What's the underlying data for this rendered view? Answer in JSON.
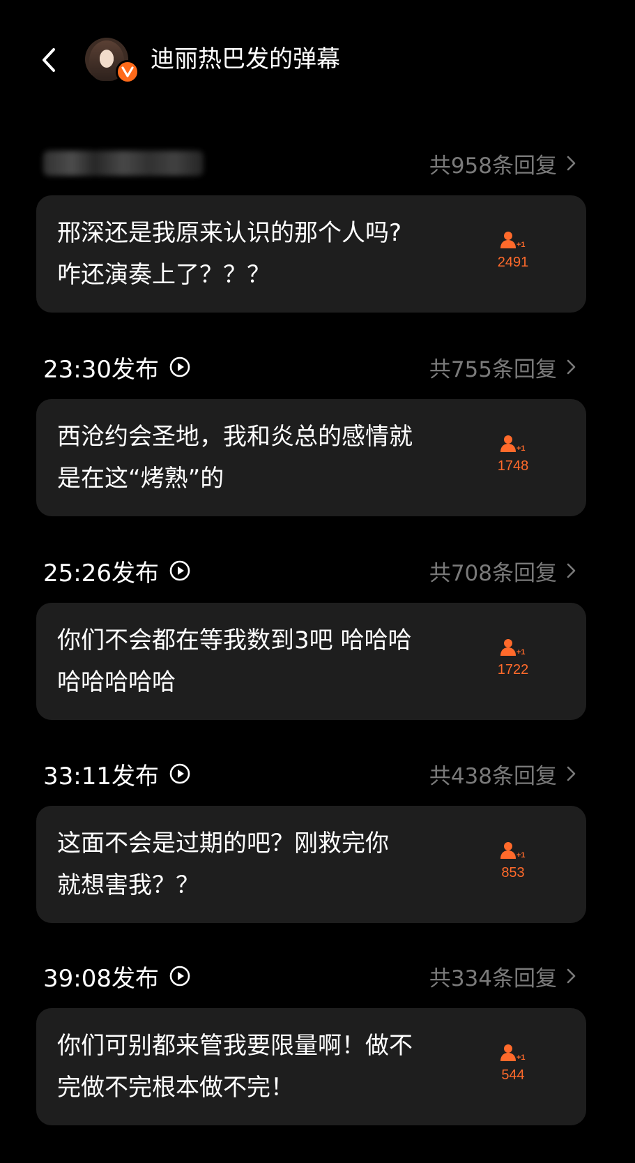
{
  "header": {
    "title": "迪丽热巴发的弹幕"
  },
  "colors": {
    "background": "#000000",
    "card": "#1e1e1e",
    "accent": "#ff6a2b",
    "muted_text": "#7a7a7a",
    "verified_badge": "#ff6a1a"
  },
  "icons": {
    "back": "chevron-left-icon",
    "verified": "v-badge-icon",
    "play": "play-circle-icon",
    "chevron": "chevron-right-icon",
    "like": "person-plus-one-icon"
  },
  "like_badge_text": "+1",
  "comments": [
    {
      "time": "",
      "time_blurred": true,
      "replies": "共958条回复",
      "text": "邢深还是我原来认识的那个人吗?\n咋还演奏上了？？？",
      "likes": "2491"
    },
    {
      "time": "23:30发布",
      "replies": "共755条回复",
      "text": "西沧约会圣地，我和炎总的感情就\n是在这“烤熟”的",
      "likes": "1748"
    },
    {
      "time": "25:26发布",
      "replies": "共708条回复",
      "text": "你们不会都在等我数到3吧 哈哈哈\n哈哈哈哈哈",
      "likes": "1722"
    },
    {
      "time": "33:11发布",
      "replies": "共438条回复",
      "text": "这面不会是过期的吧？刚救完你\n就想害我？？",
      "likes": "853"
    },
    {
      "time": "39:08发布",
      "replies": "共334条回复",
      "text": "你们可别都来管我要限量啊！做不\n完做不完根本做不完！",
      "likes": "544"
    }
  ]
}
